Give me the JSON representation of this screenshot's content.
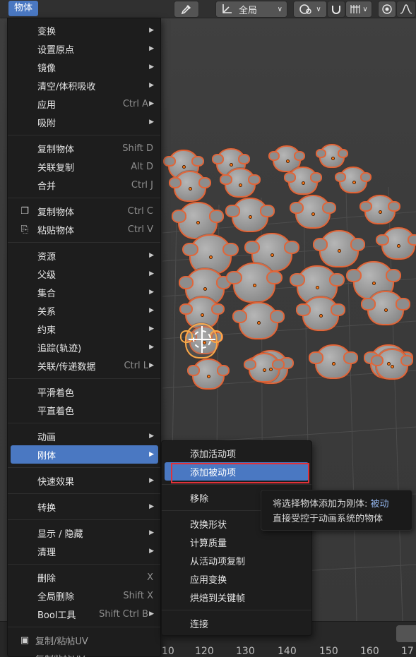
{
  "header": {
    "object_menu_label": "物体",
    "transform_orientation": "全局",
    "icons": [
      "eyedropper-icon",
      "transform-orientation-icon",
      "pivot-icon",
      "snap-icon",
      "snap-grid-icon",
      "proportional-edit-icon",
      "falloff-icon"
    ]
  },
  "menu": {
    "groups": [
      [
        {
          "label": "变换",
          "submenu": true
        },
        {
          "label": "设置原点",
          "submenu": true
        },
        {
          "label": "镜像",
          "submenu": true
        },
        {
          "label": "清空/体积吸收",
          "submenu": true
        },
        {
          "label": "应用",
          "shortcut": "Ctrl A",
          "submenu": true
        },
        {
          "label": "吸附",
          "submenu": true
        }
      ],
      [
        {
          "label": "复制物体",
          "shortcut": "Shift D"
        },
        {
          "label": "关联复制",
          "shortcut": "Alt D"
        },
        {
          "label": "合并",
          "shortcut": "Ctrl J"
        }
      ],
      [
        {
          "label": "复制物体",
          "shortcut": "Ctrl C",
          "icon": "copy-icon"
        },
        {
          "label": "粘贴物体",
          "shortcut": "Ctrl V",
          "icon": "paste-icon"
        }
      ],
      [
        {
          "label": "资源",
          "submenu": true
        },
        {
          "label": "父级",
          "submenu": true
        },
        {
          "label": "集合",
          "submenu": true
        },
        {
          "label": "关系",
          "submenu": true
        },
        {
          "label": "约束",
          "submenu": true
        },
        {
          "label": "追踪(轨迹)",
          "submenu": true
        },
        {
          "label": "关联/传递数据",
          "shortcut": "Ctrl L",
          "submenu": true
        }
      ],
      [
        {
          "label": "平滑着色"
        },
        {
          "label": "平直着色"
        }
      ],
      [
        {
          "label": "动画",
          "submenu": true
        },
        {
          "label": "刚体",
          "submenu": true,
          "highlighted": true
        }
      ],
      [
        {
          "label": "快速效果",
          "submenu": true
        }
      ],
      [
        {
          "label": "转换",
          "submenu": true
        }
      ],
      [
        {
          "label": "显示 / 隐藏",
          "submenu": true
        },
        {
          "label": "清理",
          "submenu": true
        }
      ],
      [
        {
          "label": "删除",
          "shortcut": "X"
        },
        {
          "label": "全局删除",
          "shortcut": "Shift X"
        },
        {
          "label": "Bool工具",
          "shortcut": "Shift Ctrl B",
          "submenu": true
        }
      ],
      [
        {
          "label": "复制/粘帖UV",
          "icon": "uv-copy-icon",
          "dim": true
        },
        {
          "label": "复制粘帖UV",
          "dim": true
        }
      ]
    ]
  },
  "submenu": {
    "groups": [
      [
        {
          "label": "添加活动项"
        },
        {
          "label": "添加被动项",
          "highlighted": true
        }
      ],
      [
        {
          "label": "移除"
        }
      ],
      [
        {
          "label": "改换形状"
        },
        {
          "label": "计算质量"
        },
        {
          "label": "从活动项复制"
        },
        {
          "label": "应用变换"
        },
        {
          "label": "烘焙到关键帧"
        }
      ],
      [
        {
          "label": "连接"
        }
      ]
    ]
  },
  "tooltip": {
    "line1_prefix": "将选择物体添加为刚体: ",
    "line1_value": "被动",
    "line2": "直接受控于动画系统的物体"
  },
  "timeline": {
    "frames": [
      "110",
      "120",
      "130",
      "140",
      "150",
      "160",
      "17"
    ]
  }
}
